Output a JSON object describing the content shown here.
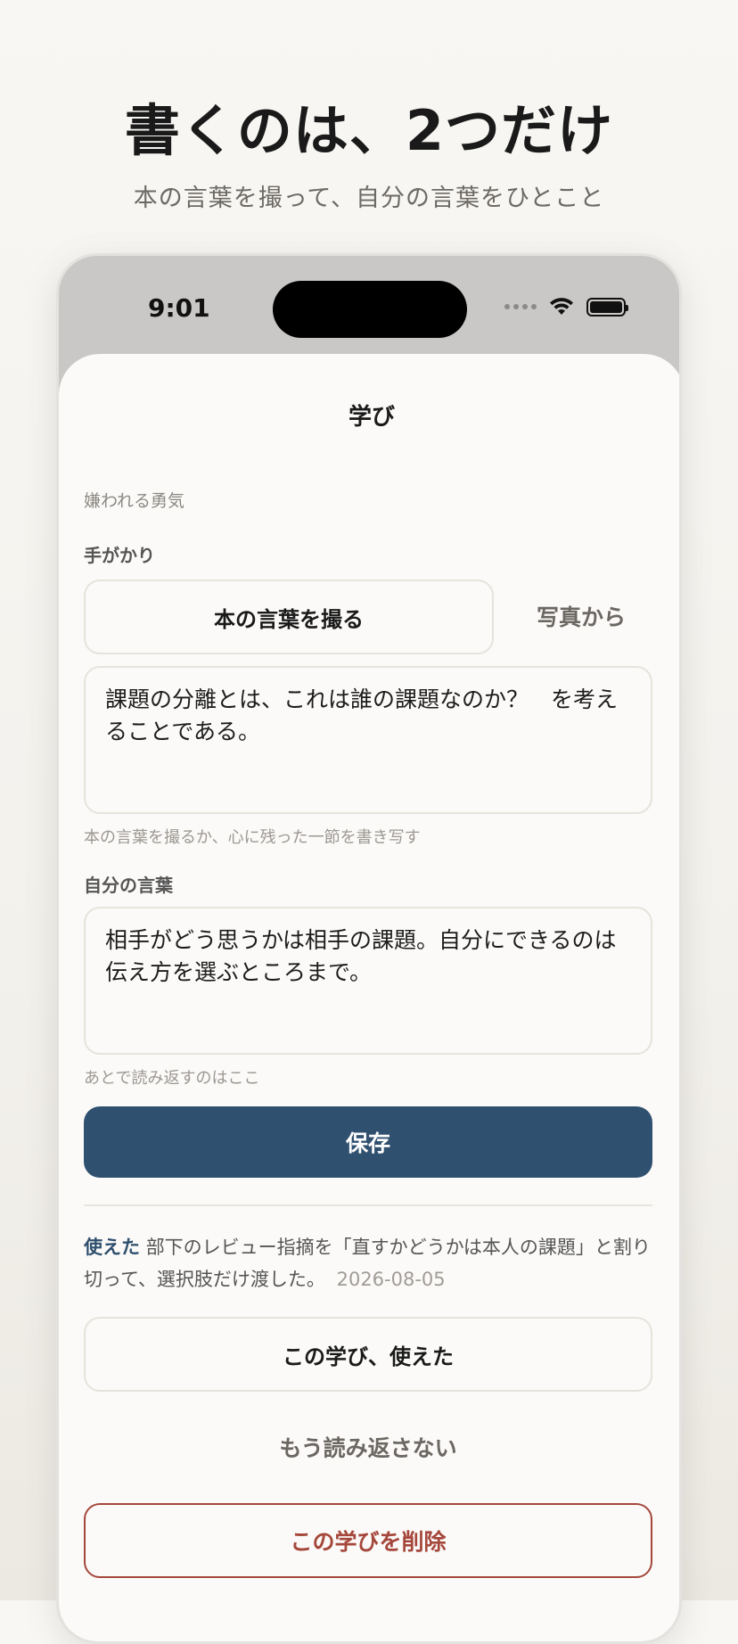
{
  "promo": {
    "title": "書くのは、2つだけ",
    "subtitle": "本の言葉を撮って、自分の言葉をひとこと"
  },
  "status_bar": {
    "time": "9:01"
  },
  "sheet": {
    "title": "学び",
    "book_name": "嫌われる勇気",
    "clue": {
      "label": "手がかり",
      "capture_button": "本の言葉を撮る",
      "photo_button": "写真から",
      "text": "課題の分離とは、これは誰の課題なのか？　を考えることである。",
      "hint": "本の言葉を撮るか、心に残った一節を書き写す"
    },
    "own_words": {
      "label": "自分の言葉",
      "text": "相手がどう思うかは相手の課題。自分にできるのは伝え方を選ぶところまで。",
      "hint": "あとで読み返すのはここ"
    },
    "save_button": "保存",
    "used_note": {
      "tag": "使えた",
      "text": "部下のレビュー指摘を「直すかどうかは本人の課題」と割り切って、選択肢だけ渡した。",
      "date": "2026-08-05"
    },
    "used_button": "この学び、使えた",
    "no_reread_button": "もう読み返さない",
    "delete_button": "この学びを削除"
  },
  "colors": {
    "accent": "#30506f",
    "danger": "#a5473b",
    "background": "#fbfaf8"
  }
}
